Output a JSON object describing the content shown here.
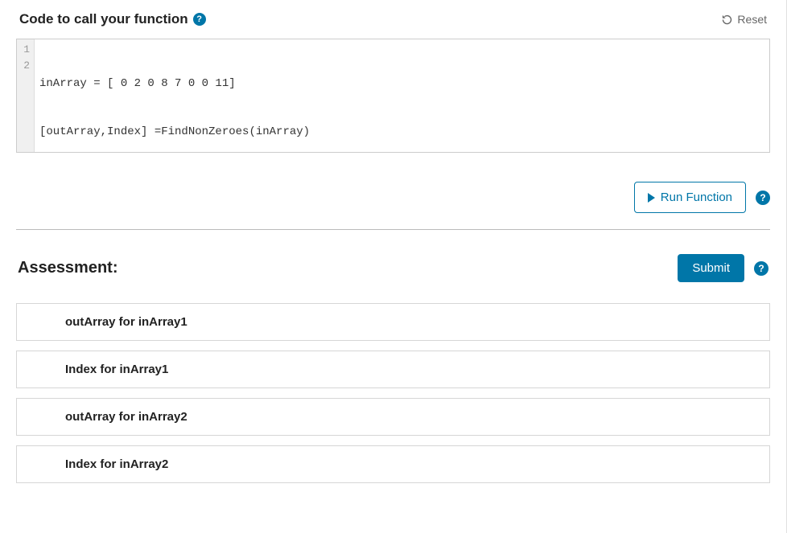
{
  "header": {
    "title": "Code to call your function",
    "reset_label": "Reset"
  },
  "editor": {
    "lines": [
      {
        "num": "1",
        "text": "inArray = [ 0 2 0 8 7 0 0 11]"
      },
      {
        "num": "2",
        "text": "[outArray,Index] =FindNonZeroes(inArray)"
      }
    ]
  },
  "run": {
    "label": "Run Function"
  },
  "assessment": {
    "title": "Assessment:",
    "submit_label": "Submit",
    "items": [
      "outArray for inArray1",
      "Index for inArray1",
      "outArray for inArray2",
      "Index for inArray2"
    ]
  },
  "icons": {
    "help_glyph": "?"
  }
}
